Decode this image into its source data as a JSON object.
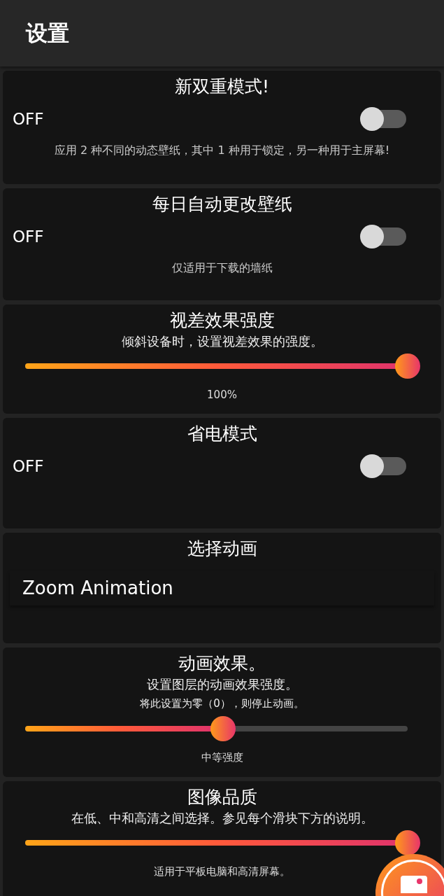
{
  "header": {
    "title": "设置"
  },
  "cards": [
    {
      "kind": "toggle",
      "title": "新双重模式!",
      "toggle": {
        "label": "OFF",
        "on": false
      },
      "note": "应用 2 种不同的动态壁纸，其中 1 种用于锁定，另一种用于主屏幕!"
    },
    {
      "kind": "toggle",
      "title": "每日自动更改壁纸",
      "toggle": {
        "label": "OFF",
        "on": false
      },
      "note": "仅适用于下载的墙纸"
    },
    {
      "kind": "slider",
      "title": "视差效果强度",
      "descriptions": [
        "倾斜设备时，设置视差效果的强度。"
      ],
      "slider": {
        "level": 1,
        "reading": "100%"
      }
    },
    {
      "kind": "toggle",
      "title": "省电模式",
      "toggle": {
        "label": "OFF",
        "on": false
      }
    },
    {
      "kind": "select",
      "title": "选择动画",
      "value": "Zoom Animation"
    },
    {
      "kind": "slider",
      "title": "动画效果。",
      "descriptions": [
        "设置图层的动画效果强度。",
        "将此设置为零（0），则停止动画。"
      ],
      "slider": {
        "level": 0.5,
        "reading": "中等强度"
      }
    },
    {
      "kind": "slider",
      "title": "图像品质",
      "descriptions": [
        "在低、中和高清之间选择。参见每个滑块下方的说明。"
      ],
      "slider": {
        "level": 1,
        "reading": "适用于平板电脑和高清屏幕。"
      }
    }
  ]
}
